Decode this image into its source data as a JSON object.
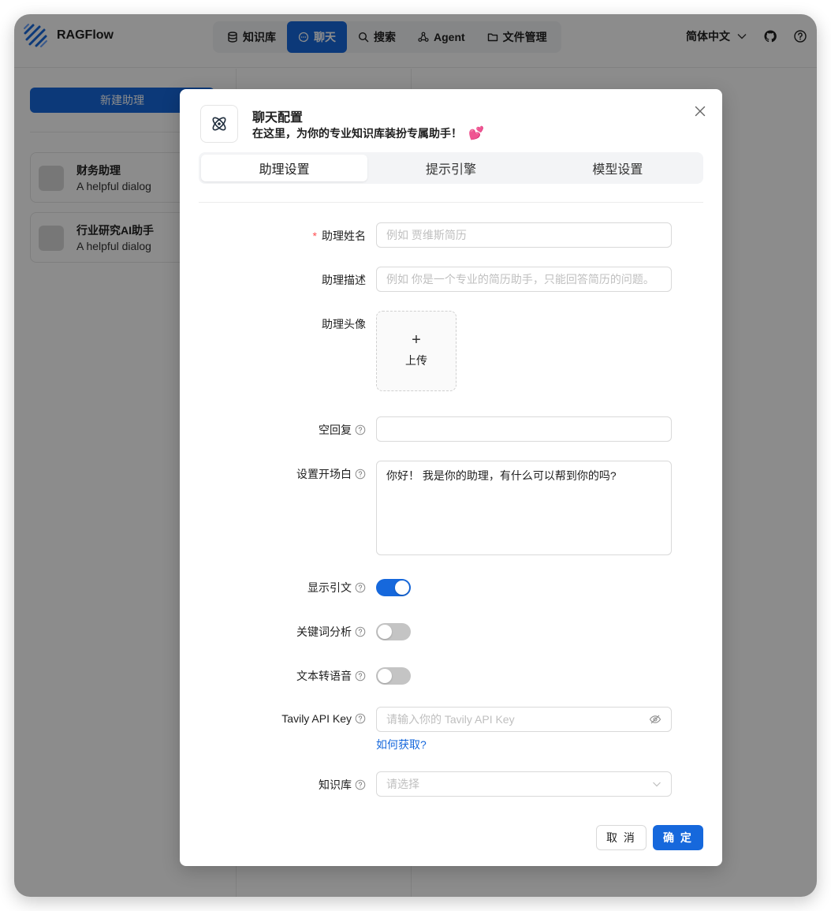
{
  "app": {
    "name": "RAGFlow"
  },
  "nav": {
    "items": [
      {
        "label": "知识库",
        "icon": "database-icon",
        "active": false
      },
      {
        "label": "聊天",
        "icon": "chat-icon",
        "active": true
      },
      {
        "label": "搜索",
        "icon": "search-icon",
        "active": false
      },
      {
        "label": "Agent",
        "icon": "agent-icon",
        "active": false
      },
      {
        "label": "文件管理",
        "icon": "folder-icon",
        "active": false
      }
    ]
  },
  "header": {
    "language": "简体中文"
  },
  "sidebar": {
    "new_button": "新建助理",
    "assistants": [
      {
        "name": "财务助理",
        "description": "A helpful dialog"
      },
      {
        "name": "行业研究AI助手",
        "description": "A helpful dialog"
      }
    ]
  },
  "modal": {
    "title": "聊天配置",
    "subtitle": "在这里，为你的专业知识库装扮专属助手！",
    "emoji": "💕",
    "tabs": [
      "助理设置",
      "提示引擎",
      "模型设置"
    ],
    "active_tab": 0,
    "fields": {
      "name": {
        "label": "助理姓名",
        "required_mark": "*",
        "placeholder": "例如 贾维斯简历",
        "value": ""
      },
      "description": {
        "label": "助理描述",
        "placeholder": "例如 你是一个专业的简历助手，只能回答简历的问题。",
        "value": ""
      },
      "avatar": {
        "label": "助理头像",
        "upload_icon": "+",
        "upload_label": "上传"
      },
      "empty_reply": {
        "label": "空回复",
        "value": ""
      },
      "opener": {
        "label": "设置开场白",
        "value": "你好！ 我是你的助理，有什么可以帮到你的吗?"
      },
      "show_quote": {
        "label": "显示引文",
        "on": true
      },
      "keyword": {
        "label": "关键词分析",
        "on": false
      },
      "tts": {
        "label": "文本转语音",
        "on": false
      },
      "tavily": {
        "label": "Tavily API Key",
        "placeholder": "请输入你的 Tavily API Key",
        "value": "",
        "help_link": "如何获取?"
      },
      "kb": {
        "label": "知识库",
        "placeholder": "请选择"
      }
    },
    "buttons": {
      "cancel": "取 消",
      "ok": "确 定"
    }
  },
  "colors": {
    "primary": "#1668dc",
    "required": "#ff4d4f"
  }
}
